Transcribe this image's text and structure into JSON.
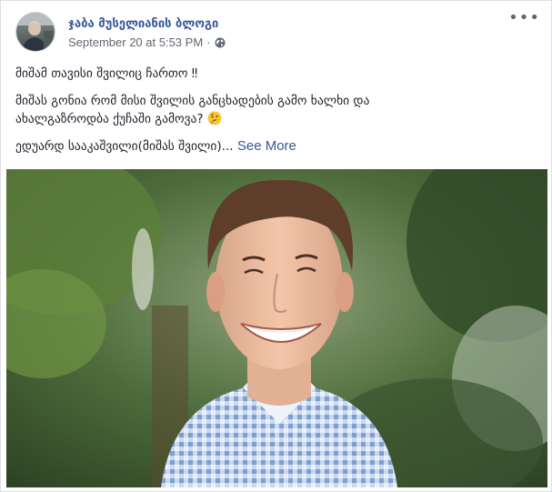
{
  "post": {
    "author": "ჯაბა მუსელიანის ბლოგი",
    "timestamp": "September 20 at 5:53 PM",
    "separator": "·",
    "privacy_icon": "globe-icon",
    "options_icon": "more-options-icon",
    "options_glyph": "•••",
    "lines": [
      "მიშამ თავისი შვილიც ჩართო ‼",
      "მიშას გონია რომ მისი შვილის განცხადების გამო ხალხი და",
      "ახალგაზროდბა ქუჩაში გამოვა?",
      "ედუარდ სააკაშვილი(მიშას შვილი)..."
    ],
    "see_more": "See More",
    "emoji": "thinking-face",
    "colors": {
      "link": "#385898",
      "secondary_text": "#606770",
      "body_text": "#1d2129"
    }
  }
}
